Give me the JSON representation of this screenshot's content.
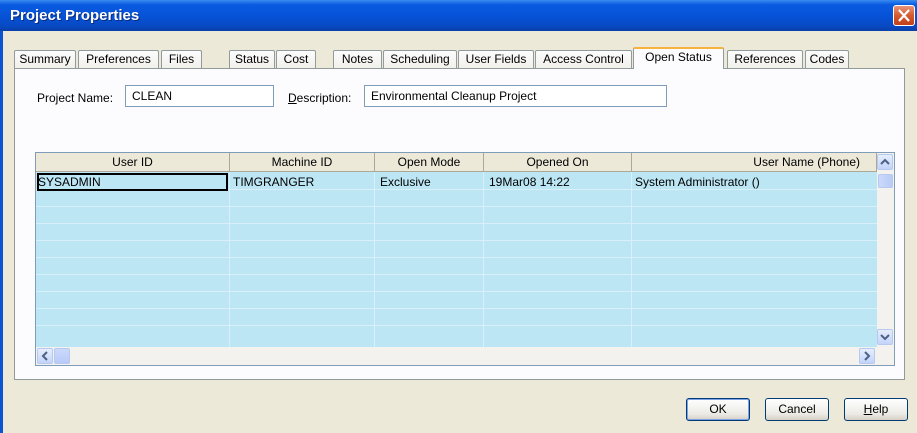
{
  "window": {
    "title": "Project Properties"
  },
  "tabs": [
    {
      "label": "Summary"
    },
    {
      "label": "Preferences"
    },
    {
      "label": "Files"
    },
    {
      "label": "Status"
    },
    {
      "label": "Cost"
    },
    {
      "label": "Notes"
    },
    {
      "label": "Scheduling"
    },
    {
      "label": "User Fields"
    },
    {
      "label": "Access Control"
    },
    {
      "label": "Open Status"
    },
    {
      "label": "References"
    },
    {
      "label": "Codes"
    }
  ],
  "active_tab": "Open Status",
  "form": {
    "project_name_label": "Project Name:",
    "project_name_value": "CLEAN",
    "description_label_u": "D",
    "description_label_rest": "escription:",
    "description_value": "Environmental Cleanup Project"
  },
  "table": {
    "columns": [
      "User ID",
      "Machine ID",
      "Open Mode",
      "Opened On",
      "User Name (Phone)"
    ],
    "rows": [
      [
        "SYSADMIN",
        "TIMGRANGER",
        "Exclusive",
        "19Mar08 14:22",
        "System Administrator ()"
      ]
    ]
  },
  "buttons": {
    "ok": "OK",
    "cancel": "Cancel",
    "help_u": "H",
    "help_rest": "elp"
  },
  "colors": {
    "title_bar": "#0653d8",
    "row_fill": "#bde6f5",
    "active_tab_accent": "#f7b33d"
  },
  "icons": [
    "close-icon",
    "scroll-up-arrow-icon",
    "scroll-down-arrow-icon",
    "scroll-left-arrow-icon",
    "scroll-right-arrow-icon"
  ]
}
